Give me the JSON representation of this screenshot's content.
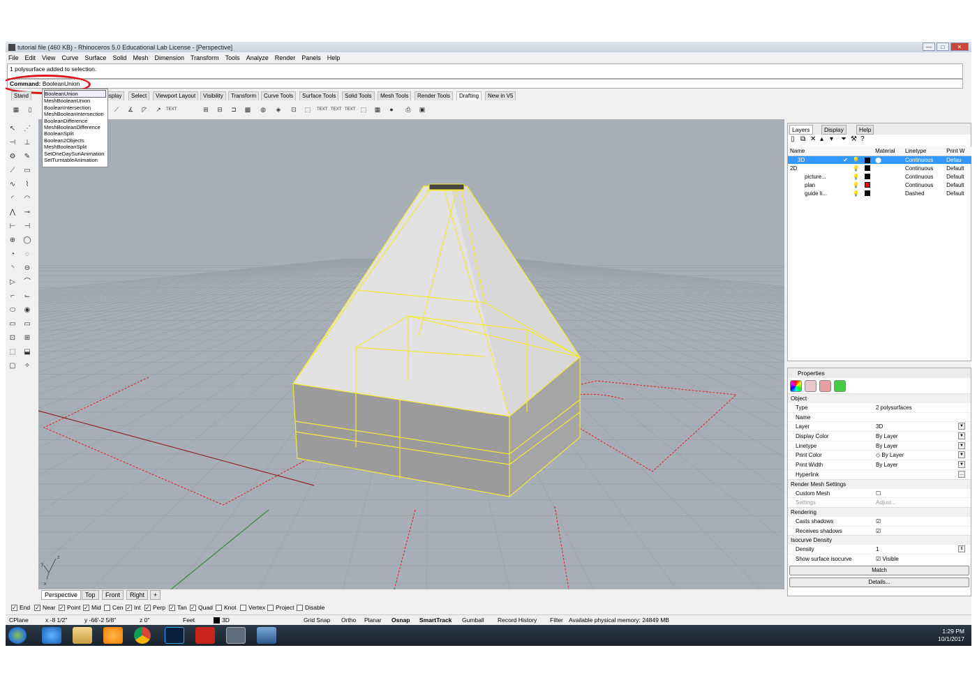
{
  "window": {
    "title": "tutorial file (460 KB) - Rhinoceros 5.0 Educational Lab License - [Perspective]",
    "controls": [
      "—",
      "□",
      "✕"
    ]
  },
  "menu": [
    "File",
    "Edit",
    "View",
    "Curve",
    "Surface",
    "Solid",
    "Mesh",
    "Dimension",
    "Transform",
    "Tools",
    "Analyze",
    "Render",
    "Panels",
    "Help"
  ],
  "command": {
    "history": "1 polysurface added to selection.",
    "label": "Command:",
    "value": "BooleanUnion",
    "autocomplete": [
      "BooleanUnion",
      "MeshBooleanUnion",
      "BooleanIntersection",
      "MeshBooleanIntersection",
      "BooleanDifference",
      "MeshBooleanDifference",
      "BooleanSplit",
      "Boolean2Objects",
      "MeshBooleanSplit",
      "SetOneDaySunAnimation",
      "SetTurntableAnimation"
    ]
  },
  "toolbar_tabs": [
    "Stand",
    "isplay",
    "Select",
    "Viewport Layout",
    "Visibility",
    "Transform",
    "Curve Tools",
    "Surface Tools",
    "Solid Tools",
    "Mesh Tools",
    "Render Tools",
    "Drafting",
    "New in V5"
  ],
  "toolbar_text_icons": [
    "TEXT",
    "TEXT",
    "TEXT",
    "TEXT"
  ],
  "viewport_tabs": [
    "Perspective",
    "Top",
    "Front",
    "Right",
    "+"
  ],
  "axis_labels": {
    "z": "z",
    "y": "y",
    "x": "x"
  },
  "layers_panel": {
    "tabs": [
      "Layers",
      "Display",
      "Help"
    ],
    "columns": [
      "Name",
      "Material",
      "Linetype",
      "Print W"
    ],
    "rows": [
      {
        "name": "3D",
        "check": "✔",
        "color": "#000000",
        "linetype": "Continuous",
        "print": "Defau",
        "selected": true,
        "indent": false
      },
      {
        "name": "2D",
        "check": "",
        "color": "#000000",
        "linetype": "Continuous",
        "print": "Default",
        "selected": false,
        "indent": false
      },
      {
        "name": "picture...",
        "check": "",
        "color": "#000000",
        "linetype": "Continuous",
        "print": "Default",
        "selected": false,
        "indent": true
      },
      {
        "name": "plan",
        "check": "",
        "color": "#e01010",
        "linetype": "Continuous",
        "print": "Default",
        "selected": false,
        "indent": true
      },
      {
        "name": "guide li...",
        "check": "",
        "color": "#000000",
        "linetype": "Dashed",
        "print": "Default",
        "selected": false,
        "indent": true
      }
    ]
  },
  "properties_panel": {
    "title": "Properties",
    "groups": [
      {
        "name": "Object",
        "rows": [
          {
            "key": "Type",
            "value": "2 polysurfaces",
            "dd": false
          },
          {
            "key": "Name",
            "value": "",
            "dd": false
          },
          {
            "key": "Layer",
            "value": "3D",
            "dd": true
          },
          {
            "key": "Display Color",
            "value": "By Layer",
            "dd": true
          },
          {
            "key": "Linetype",
            "value": "By Layer",
            "dd": true
          },
          {
            "key": "Print Color",
            "value": "◇ By Layer",
            "dd": true
          },
          {
            "key": "Print Width",
            "value": "By Layer",
            "dd": true
          },
          {
            "key": "Hyperlink",
            "value": "",
            "dd": true
          }
        ]
      },
      {
        "name": "Render Mesh Settings",
        "rows": [
          {
            "key": "Custom Mesh",
            "value": "☐",
            "dd": false
          },
          {
            "key": "Settings",
            "value": "Adjust...",
            "dd": false
          }
        ]
      },
      {
        "name": "Rendering",
        "rows": [
          {
            "key": "Casts shadows",
            "value": "☑",
            "dd": false
          },
          {
            "key": "Receives shadows",
            "value": "☑",
            "dd": false
          }
        ]
      },
      {
        "name": "Isocurve Density",
        "rows": [
          {
            "key": "Density",
            "value": "1",
            "dd": true
          },
          {
            "key": "Show surface isocurve",
            "value": "☑ Visible",
            "dd": false
          }
        ]
      }
    ],
    "buttons": [
      "Match",
      "Details..."
    ]
  },
  "osnap": [
    {
      "label": "End",
      "on": true
    },
    {
      "label": "Near",
      "on": true
    },
    {
      "label": "Point",
      "on": true
    },
    {
      "label": "Mid",
      "on": true
    },
    {
      "label": "Cen",
      "on": false
    },
    {
      "label": "Int",
      "on": true
    },
    {
      "label": "Perp",
      "on": true
    },
    {
      "label": "Tan",
      "on": true
    },
    {
      "label": "Quad",
      "on": true
    },
    {
      "label": "Knot",
      "on": false
    },
    {
      "label": "Vertex",
      "on": false
    },
    {
      "label": "Project",
      "on": false
    },
    {
      "label": "Disable",
      "on": false
    }
  ],
  "status_bar": {
    "cplane": "CPlane",
    "x": "x -8 1/2\"",
    "y": "y -66'-2 5/8\"",
    "z": "z 0\"",
    "units": "Feet",
    "layer": "3D",
    "grid_snap": "Grid Snap",
    "ortho": "Ortho",
    "planar": "Planar",
    "osnap": "Osnap",
    "smarttrack": "SmartTrack",
    "gumball": "Gumball",
    "record": "Record History",
    "filter": "Filter",
    "memory": "Available physical memory: 24849 MB"
  },
  "taskbar": {
    "time": "1:29 PM",
    "date": "10/1/2017"
  },
  "colors": {
    "selection": "#f2e83a",
    "plan_lines": "#e02020",
    "viewport_bg": "#a7aeb5",
    "grid": "#98a0a8",
    "highlight": "#3399ff"
  }
}
